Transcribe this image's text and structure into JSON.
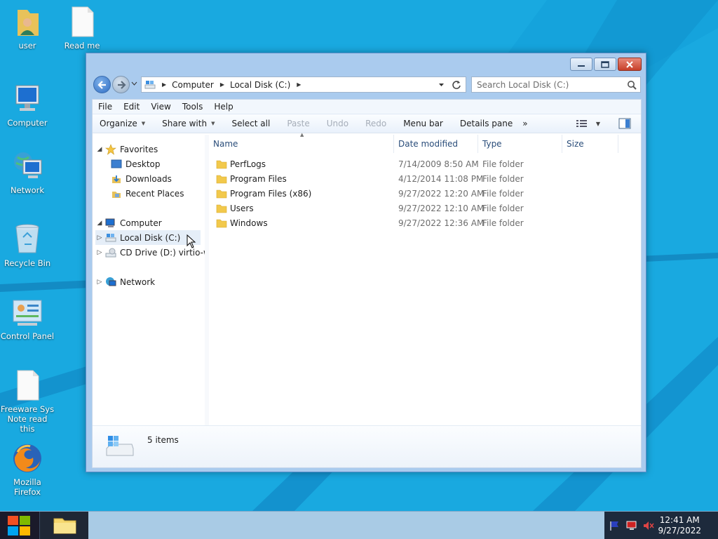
{
  "desktop": {
    "icons": [
      {
        "label": "user",
        "icon": "user-folder-icon"
      },
      {
        "label": "Read me",
        "icon": "document-icon"
      },
      {
        "label": "Computer",
        "icon": "computer-icon"
      },
      {
        "label": "Network",
        "icon": "network-icon"
      },
      {
        "label": "Recycle Bin",
        "icon": "recycle-bin-icon"
      },
      {
        "label": "Control Panel",
        "icon": "control-panel-icon"
      },
      {
        "label": "Freeware Sys Note read this",
        "icon": "document-icon"
      },
      {
        "label": "Mozilla Firefox",
        "icon": "firefox-icon"
      }
    ]
  },
  "window": {
    "breadcrumb": [
      "Computer",
      "Local Disk (C:)"
    ],
    "search": {
      "placeholder": "Search Local Disk (C:)"
    },
    "menu": [
      "File",
      "Edit",
      "View",
      "Tools",
      "Help"
    ],
    "commands": {
      "organize": "Organize",
      "share_with": "Share with",
      "select_all": "Select all",
      "paste": "Paste",
      "undo": "Undo",
      "redo": "Redo",
      "menu_bar": "Menu bar",
      "details_pane": "Details pane",
      "more": "»"
    },
    "nav_tree": {
      "favorites": "Favorites",
      "desktop": "Desktop",
      "downloads": "Downloads",
      "recent_places": "Recent Places",
      "computer": "Computer",
      "local_disk": "Local Disk (C:)",
      "cd_drive": "CD Drive (D:) virtio-w",
      "network": "Network"
    },
    "columns": {
      "name": "Name",
      "date": "Date modified",
      "type": "Type",
      "size": "Size"
    },
    "files": [
      {
        "name": "PerfLogs",
        "date": "7/14/2009 8:50 AM",
        "type": "File folder"
      },
      {
        "name": "Program Files",
        "date": "4/12/2014 11:08 PM",
        "type": "File folder"
      },
      {
        "name": "Program Files (x86)",
        "date": "9/27/2022 12:20 AM",
        "type": "File folder"
      },
      {
        "name": "Users",
        "date": "9/27/2022 12:10 AM",
        "type": "File folder"
      },
      {
        "name": "Windows",
        "date": "9/27/2022 12:36 AM",
        "type": "File folder"
      }
    ],
    "status": {
      "count": "5 items"
    }
  },
  "taskbar": {
    "time": "12:41 AM",
    "date": "9/27/2022"
  },
  "colors": {
    "desktop": "#19a9e0",
    "window_frame": "#aacbee",
    "header_text": "#2a4d7a",
    "folder": "#f2c94c"
  }
}
